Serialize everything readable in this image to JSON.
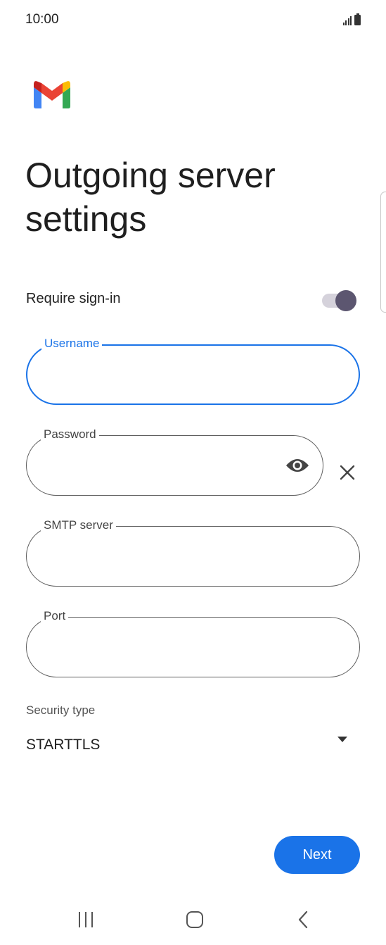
{
  "status_bar": {
    "time": "10:00"
  },
  "title": "Outgoing server settings",
  "require_signin": {
    "label": "Require sign-in",
    "enabled": true
  },
  "fields": {
    "username": {
      "label": "Username",
      "value": ""
    },
    "password": {
      "label": "Password",
      "value": ""
    },
    "smtp_server": {
      "label": "SMTP server",
      "value": ""
    },
    "port": {
      "label": "Port",
      "value": ""
    }
  },
  "security": {
    "label": "Security type",
    "selected": "STARTTLS"
  },
  "next_label": "Next",
  "colors": {
    "accent": "#1a73e8",
    "toggle_thumb": "#5c5670",
    "toggle_track": "#d5d2db"
  },
  "icons": [
    "gmail-logo",
    "signal-icon",
    "battery-icon",
    "visibility-icon",
    "close-icon",
    "dropdown-arrow-icon",
    "recents-icon",
    "home-icon",
    "back-icon"
  ]
}
